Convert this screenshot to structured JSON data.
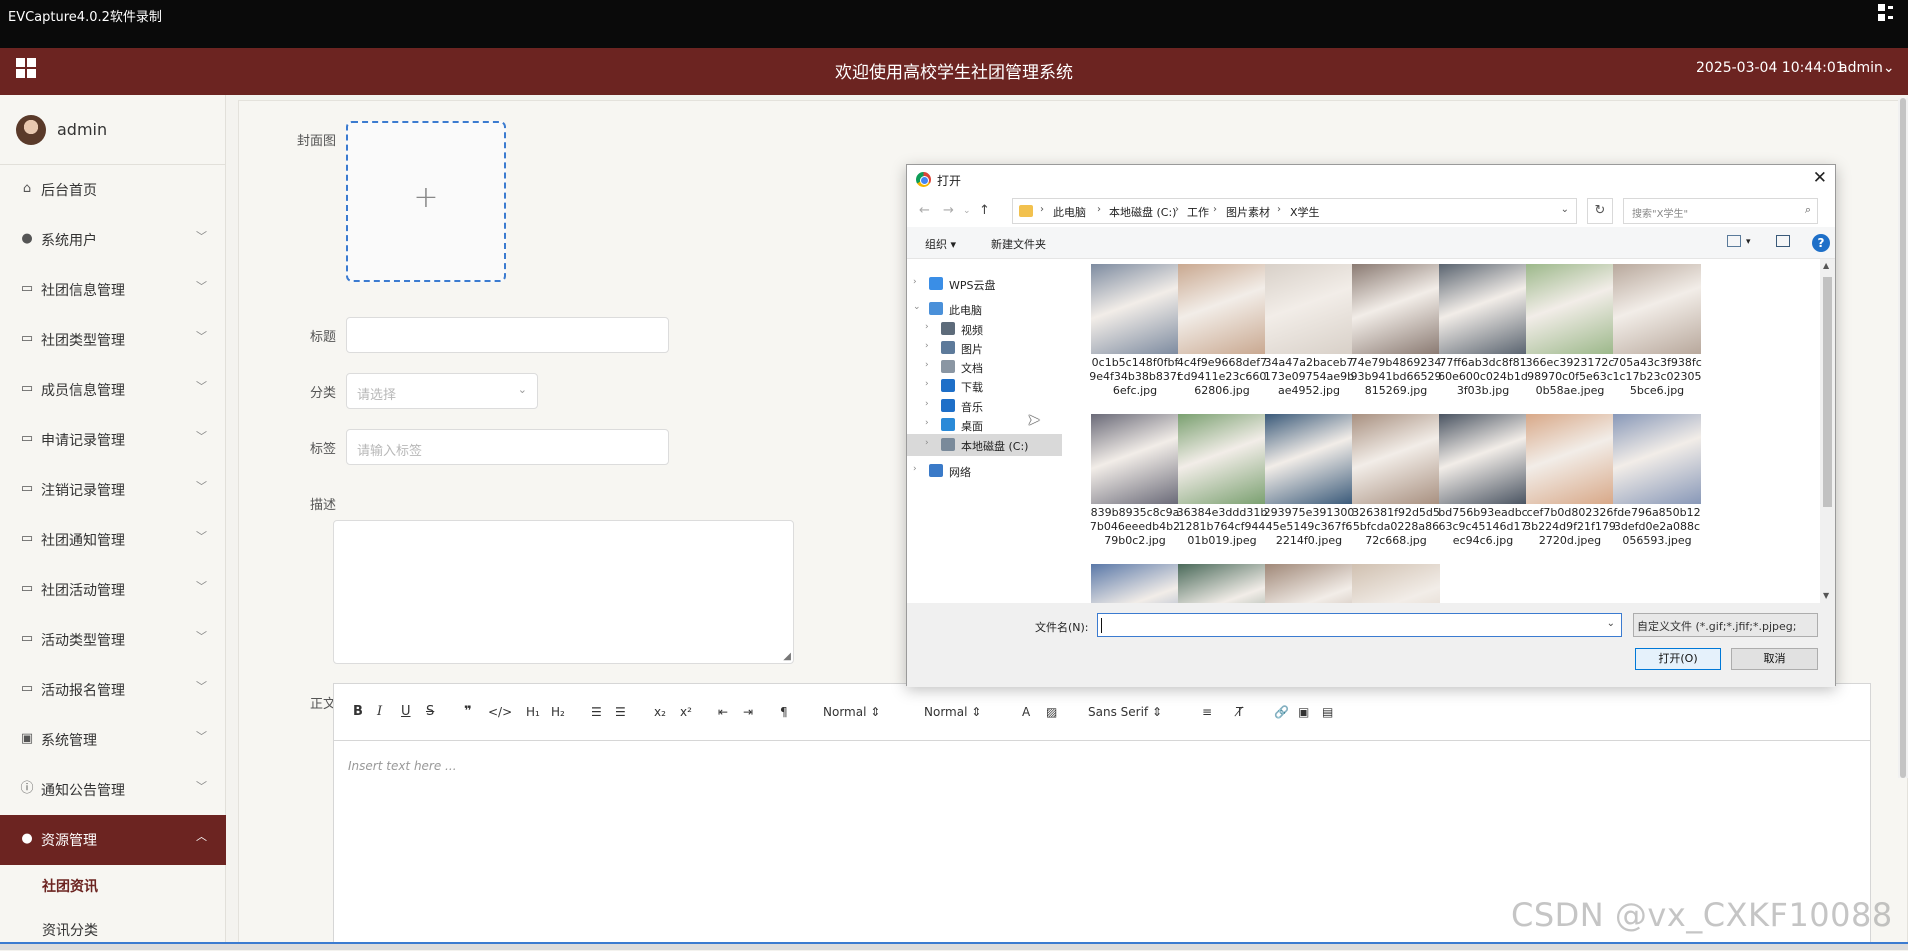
{
  "recorder": {
    "title": "EVCapture4.0.2软件录制"
  },
  "header": {
    "title": "欢迎使用高校学生社团管理系统",
    "datetime": "2025-03-04 10:44:01",
    "user": "admin⌄"
  },
  "sidebar": {
    "profile_name": "admin",
    "items": [
      {
        "label": "后台首页",
        "icon": "home-icon",
        "glyph": "⌂"
      },
      {
        "label": "系统用户",
        "icon": "user-icon",
        "glyph": "●"
      },
      {
        "label": "社团信息管理",
        "icon": "doc-icon",
        "glyph": "▭"
      },
      {
        "label": "社团类型管理",
        "icon": "doc-icon",
        "glyph": "▭"
      },
      {
        "label": "成员信息管理",
        "icon": "doc-icon",
        "glyph": "▭"
      },
      {
        "label": "申请记录管理",
        "icon": "doc-icon",
        "glyph": "▭"
      },
      {
        "label": "注销记录管理",
        "icon": "doc-icon",
        "glyph": "▭"
      },
      {
        "label": "社团通知管理",
        "icon": "doc-icon",
        "glyph": "▭"
      },
      {
        "label": "社团活动管理",
        "icon": "doc-icon",
        "glyph": "▭"
      },
      {
        "label": "活动类型管理",
        "icon": "doc-icon",
        "glyph": "▭"
      },
      {
        "label": "活动报名管理",
        "icon": "doc-icon",
        "glyph": "▭"
      },
      {
        "label": "系统管理",
        "icon": "image-icon",
        "glyph": "▣"
      },
      {
        "label": "通知公告管理",
        "icon": "info-icon",
        "glyph": "ⓘ"
      },
      {
        "label": "资源管理",
        "icon": "bulb-icon",
        "glyph": "●"
      }
    ],
    "submenu": [
      {
        "label": "社团资讯"
      },
      {
        "label": "资讯分类"
      }
    ]
  },
  "form": {
    "cover_label": "封面图",
    "title_label": "标题",
    "category_label": "分类",
    "category_placeholder": "请选择",
    "tags_label": "标签",
    "tags_placeholder": "请输入标签",
    "desc_label": "描述",
    "body_label": "正文"
  },
  "editor": {
    "header_select": "Normal",
    "size_select": "Normal",
    "font_select": "Sans Serif",
    "placeholder": "Insert text here ..."
  },
  "dialog": {
    "title": "打开",
    "breadcrumbs": [
      "此电脑",
      "本地磁盘 (C:)",
      "工作",
      "图片素材",
      "X学生"
    ],
    "search_placeholder": "搜索\"X学生\"",
    "organize": "组织 ▾",
    "new_folder": "新建文件夹",
    "nav": [
      {
        "label": "WPS云盘",
        "icon": "cloud-icon",
        "color": "#3a8ee6"
      },
      {
        "label": "此电脑",
        "icon": "computer-icon",
        "color": "#4a90d9"
      },
      {
        "label": "视频",
        "icon": "video-folder-icon",
        "color": "#5d6b7a"
      },
      {
        "label": "图片",
        "icon": "picture-folder-icon",
        "color": "#5d7a9a"
      },
      {
        "label": "文档",
        "icon": "document-folder-icon",
        "color": "#8a96a3"
      },
      {
        "label": "下载",
        "icon": "download-folder-icon",
        "color": "#1e6fc8"
      },
      {
        "label": "音乐",
        "icon": "music-folder-icon",
        "color": "#1e6fc8"
      },
      {
        "label": "桌面",
        "icon": "desktop-folder-icon",
        "color": "#2a8ad8"
      },
      {
        "label": "本地磁盘 (C:)",
        "icon": "disk-icon",
        "color": "#7a8a9a"
      },
      {
        "label": "网络",
        "icon": "network-icon",
        "color": "#3a7ac8"
      }
    ],
    "files": [
      {
        "name": "0c1b5c148f0fbf9e4f34b38b837f6efc.jpg",
        "color": "#7d8ba0"
      },
      {
        "name": "4c4f9e9668def7cd9411e23c66062806.jpg",
        "color": "#c9a890"
      },
      {
        "name": "34a47a2baceb7173e09754ae9bae4952.jpg",
        "color": "#d8d0c8"
      },
      {
        "name": "74e79b486923493b941bd66529815269.jpg",
        "color": "#8a7a72"
      },
      {
        "name": "77ff6ab3dc8f8160e600c024b1d3f03b.jpg",
        "color": "#5a6470"
      },
      {
        "name": "366ec3923172c98970c0f5e63c0b58ae.jpeg",
        "color": "#9cb88a"
      },
      {
        "name": "705a43c3f938fc1c17b23c023055bce6.jpg",
        "color": "#b8a89c"
      },
      {
        "name": "839b8935c8c9a7b046eeedb4b279b0c2.jpg",
        "color": "#6a6a78"
      },
      {
        "name": "36384e3ddd31b1281b764cf94401b019.jpeg",
        "color": "#7aa070"
      },
      {
        "name": "293975e39130045e5149c367f62214f0.jpeg",
        "color": "#3a5a7a"
      },
      {
        "name": "326381f92d5d55bfcda0228a8672c668.jpg",
        "color": "#a89080"
      },
      {
        "name": "bd756b93eadbc63c9c45146d17ec94c6.jpg",
        "color": "#4a5462"
      },
      {
        "name": "cef7b0d8023263b224d9f21f1792720d.jpeg",
        "color": "#d8a888"
      },
      {
        "name": "fde796a850b123defd0e2a088c056593.jpeg",
        "color": "#8898b8"
      },
      {
        "name": "",
        "color": "#5a78a8"
      },
      {
        "name": "",
        "color": "#4a6a5a"
      },
      {
        "name": "",
        "color": "#a08878"
      },
      {
        "name": "",
        "color": "#d0c0b0"
      }
    ],
    "filename_label": "文件名(N):",
    "filetype": "自定义文件 (*.gif;*.jfif;*.pjpeg;",
    "open_button": "打开(O)",
    "cancel_button": "取消"
  },
  "watermark": "CSDN @vx_CXKF10088"
}
